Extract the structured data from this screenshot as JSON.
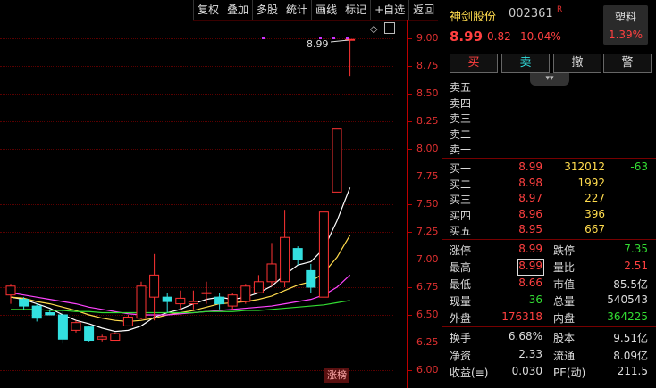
{
  "toolbar": [
    "复权",
    "叠加",
    "多股",
    "统计",
    "画线",
    "标记",
    "+自选",
    "返回"
  ],
  "chart": {
    "y_labels": [
      "9.00",
      "8.75",
      "8.50",
      "8.25",
      "8.00",
      "7.75",
      "7.50",
      "7.25",
      "7.00",
      "6.75",
      "6.50",
      "6.25",
      "6.00"
    ],
    "price_annotation": "8.99",
    "diamond_icon": "diamond-icon",
    "window_icon": "window-icon",
    "limit_up_badge": "涨榜"
  },
  "chart_data": {
    "type": "candlestick",
    "y_range": [
      6.0,
      9.1
    ],
    "candles": [
      {
        "o": 6.68,
        "c": 6.76,
        "h": 6.78,
        "l": 6.6
      },
      {
        "o": 6.64,
        "c": 6.58,
        "h": 6.66,
        "l": 6.55
      },
      {
        "o": 6.58,
        "c": 6.47,
        "h": 6.6,
        "l": 6.44
      },
      {
        "o": 6.52,
        "c": 6.5,
        "h": 6.55,
        "l": 6.5
      },
      {
        "o": 6.5,
        "c": 6.28,
        "h": 6.55,
        "l": 6.24
      },
      {
        "o": 6.36,
        "c": 6.43,
        "h": 6.45,
        "l": 6.34
      },
      {
        "o": 6.39,
        "c": 6.27,
        "h": 6.4,
        "l": 6.26
      },
      {
        "o": 6.28,
        "c": 6.3,
        "h": 6.32,
        "l": 6.26
      },
      {
        "o": 6.27,
        "c": 6.33,
        "h": 6.34,
        "l": 6.27
      },
      {
        "o": 6.4,
        "c": 6.48,
        "h": 6.5,
        "l": 6.4
      },
      {
        "o": 6.47,
        "c": 6.76,
        "h": 6.8,
        "l": 6.46
      },
      {
        "o": 6.66,
        "c": 6.86,
        "h": 7.05,
        "l": 6.45
      },
      {
        "o": 6.66,
        "c": 6.62,
        "h": 6.7,
        "l": 6.52
      },
      {
        "o": 6.6,
        "c": 6.65,
        "h": 6.72,
        "l": 6.55
      },
      {
        "o": 6.6,
        "c": 6.62,
        "h": 6.72,
        "l": 6.55
      },
      {
        "o": 6.7,
        "c": 6.7,
        "h": 6.8,
        "l": 6.6
      },
      {
        "o": 6.66,
        "c": 6.6,
        "h": 6.7,
        "l": 6.55
      },
      {
        "o": 6.58,
        "c": 6.68,
        "h": 6.7,
        "l": 6.55
      },
      {
        "o": 6.62,
        "c": 6.76,
        "h": 6.78,
        "l": 6.6
      },
      {
        "o": 6.7,
        "c": 6.8,
        "h": 6.86,
        "l": 6.7
      },
      {
        "o": 6.8,
        "c": 6.96,
        "h": 7.15,
        "l": 6.76
      },
      {
        "o": 6.8,
        "c": 7.2,
        "h": 7.45,
        "l": 6.75
      },
      {
        "o": 7.1,
        "c": 7.0,
        "h": 7.12,
        "l": 6.95
      },
      {
        "o": 6.9,
        "c": 6.75,
        "h": 6.96,
        "l": 6.7
      },
      {
        "o": 6.66,
        "c": 7.43,
        "h": 7.43,
        "l": 6.66
      },
      {
        "o": 7.61,
        "c": 8.18,
        "h": 8.18,
        "l": 7.61
      },
      {
        "o": 8.99,
        "c": 8.99,
        "h": 8.99,
        "l": 8.66
      }
    ],
    "ma_lines": [
      {
        "name": "MA5",
        "color": "#ffffff",
        "values": [
          6.66,
          6.64,
          6.6,
          6.56,
          6.5,
          6.45,
          6.42,
          6.38,
          6.35,
          6.36,
          6.4,
          6.48,
          6.52,
          6.55,
          6.6,
          6.64,
          6.66,
          6.64,
          6.66,
          6.7,
          6.76,
          6.86,
          6.95,
          6.98,
          7.1,
          7.35,
          7.65
        ]
      },
      {
        "name": "MA10",
        "color": "#ffdb4d",
        "values": [
          6.66,
          6.65,
          6.62,
          6.6,
          6.57,
          6.54,
          6.5,
          6.47,
          6.45,
          6.44,
          6.45,
          6.47,
          6.5,
          6.52,
          6.54,
          6.57,
          6.6,
          6.61,
          6.62,
          6.64,
          6.67,
          6.72,
          6.77,
          6.8,
          6.88,
          7.02,
          7.22
        ]
      },
      {
        "name": "MA20",
        "color": "#ff44ff",
        "values": [
          6.7,
          6.68,
          6.66,
          6.64,
          6.62,
          6.6,
          6.57,
          6.55,
          6.53,
          6.51,
          6.5,
          6.5,
          6.5,
          6.51,
          6.52,
          6.53,
          6.54,
          6.55,
          6.56,
          6.57,
          6.58,
          6.6,
          6.62,
          6.64,
          6.68,
          6.75,
          6.86
        ]
      },
      {
        "name": "MA60",
        "color": "#33dd33",
        "values": [
          6.55,
          6.55,
          6.55,
          6.54,
          6.54,
          6.53,
          6.53,
          6.52,
          6.52,
          6.52,
          6.52,
          6.52,
          6.52,
          6.52,
          6.52,
          6.53,
          6.53,
          6.53,
          6.54,
          6.54,
          6.55,
          6.56,
          6.57,
          6.58,
          6.59,
          6.61,
          6.63
        ]
      }
    ],
    "purple_dots": [
      9.0,
      9.0,
      9.0,
      9.0
    ]
  },
  "quote": {
    "name": "神剑股份",
    "code": "002361",
    "r_mark": "R",
    "price": "8.99",
    "change": "0.82",
    "pct": "10.04%",
    "tag": "塑料",
    "tag_pct": "1.39%"
  },
  "trade_buttons": [
    "买",
    "卖",
    "撤",
    "警"
  ],
  "collapse_glyph": "▾▾",
  "asks": [
    {
      "label": "卖五",
      "price": "",
      "vol": ""
    },
    {
      "label": "卖四",
      "price": "",
      "vol": ""
    },
    {
      "label": "卖三",
      "price": "",
      "vol": ""
    },
    {
      "label": "卖二",
      "price": "",
      "vol": ""
    },
    {
      "label": "卖一",
      "price": "",
      "vol": ""
    }
  ],
  "bids": [
    {
      "label": "买一",
      "price": "8.99",
      "vol": "312012",
      "diff": "-63"
    },
    {
      "label": "买二",
      "price": "8.98",
      "vol": "1992",
      "diff": ""
    },
    {
      "label": "买三",
      "price": "8.97",
      "vol": "227",
      "diff": ""
    },
    {
      "label": "买四",
      "price": "8.96",
      "vol": "396",
      "diff": ""
    },
    {
      "label": "买五",
      "price": "8.95",
      "vol": "667",
      "diff": ""
    }
  ],
  "stats1": [
    {
      "l1": "涨停",
      "v1": "8.99",
      "c1": "red",
      "l2": "跌停",
      "v2": "7.35",
      "c2": "green"
    },
    {
      "l1": "最高",
      "v1": "8.99",
      "c1": "red",
      "l2": "量比",
      "v2": "2.51",
      "c2": "red"
    },
    {
      "l1": "最低",
      "v1": "8.66",
      "c1": "red",
      "l2": "市值",
      "v2": "85.5亿",
      "c2": "white"
    },
    {
      "l1": "现量",
      "v1": "36",
      "c1": "green",
      "l2": "总量",
      "v2": "540543",
      "c2": "white"
    },
    {
      "l1": "外盘",
      "v1": "176318",
      "c1": "red",
      "l2": "内盘",
      "v2": "364225",
      "c2": "green"
    }
  ],
  "stats2": [
    {
      "l1": "换手",
      "v1": "6.68%",
      "l2": "股本",
      "v2": "9.51亿"
    },
    {
      "l1": "净资",
      "v1": "2.33",
      "l2": "流通",
      "v2": "8.09亿"
    },
    {
      "l1": "收益(≡)",
      "v1": "0.030",
      "l2": "PE(动)",
      "v2": "211.5"
    }
  ]
}
